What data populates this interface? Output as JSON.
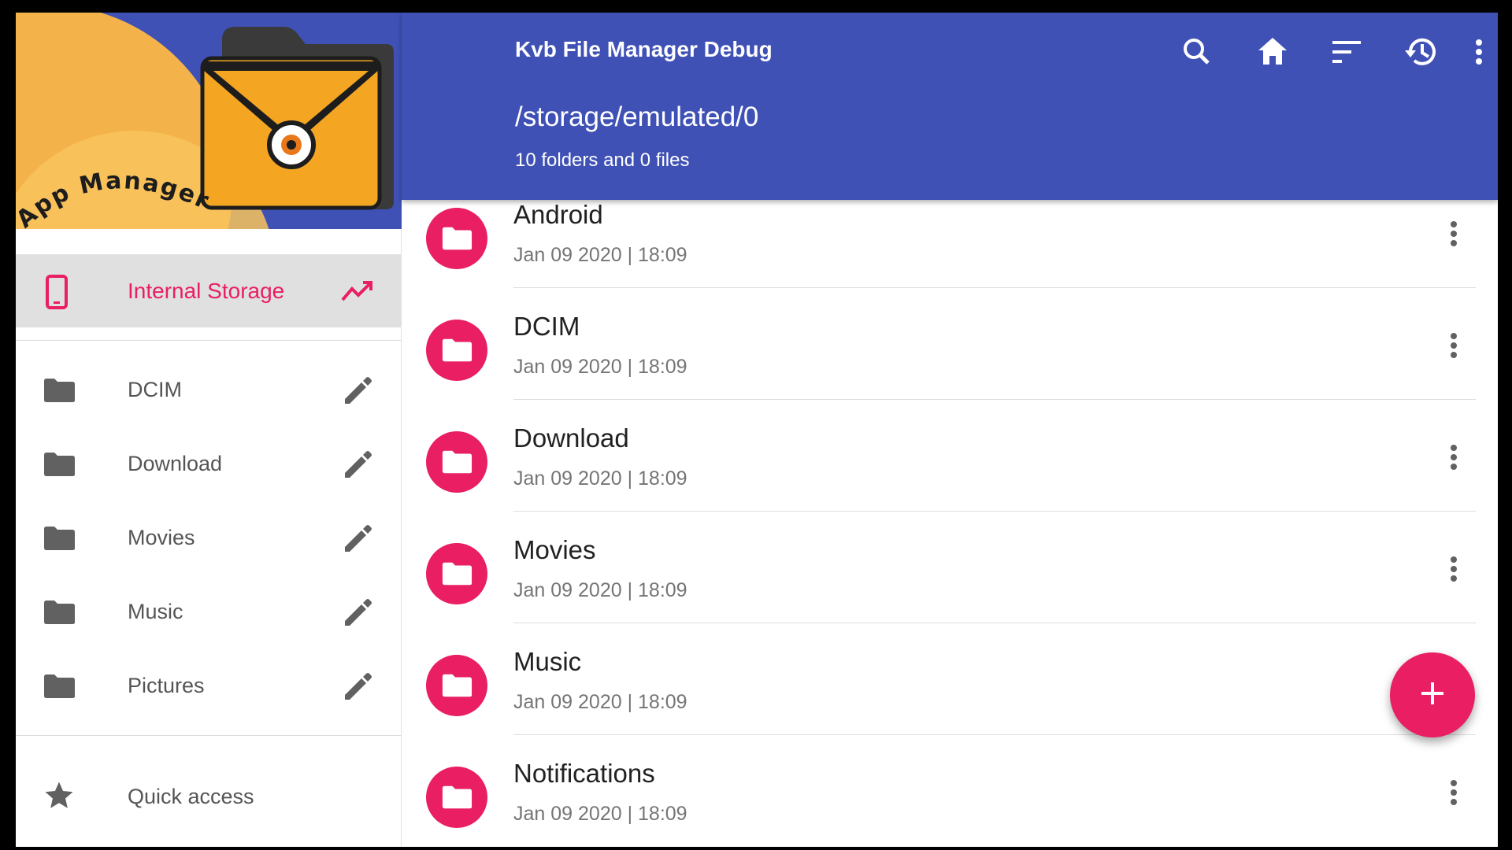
{
  "drawer": {
    "header_logo_text": "App Manager",
    "storage": {
      "label": "Internal Storage",
      "icon": "phone-icon",
      "trailing_icon": "trending-up-icon"
    },
    "bookmarks": [
      {
        "label": "DCIM",
        "icon": "folder-icon",
        "action_icon": "pencil-icon"
      },
      {
        "label": "Download",
        "icon": "folder-icon",
        "action_icon": "pencil-icon"
      },
      {
        "label": "Movies",
        "icon": "folder-icon",
        "action_icon": "pencil-icon"
      },
      {
        "label": "Music",
        "icon": "folder-icon",
        "action_icon": "pencil-icon"
      },
      {
        "label": "Pictures",
        "icon": "folder-icon",
        "action_icon": "pencil-icon"
      }
    ],
    "quick_access": {
      "label": "Quick access",
      "icon": "star-icon"
    }
  },
  "appbar": {
    "title": "Kvb File Manager Debug",
    "path": "/storage/emulated/0",
    "summary": "10 folders and 0 files",
    "actions": [
      "search-icon",
      "home-icon",
      "sort-icon",
      "history-icon",
      "more-vert-icon"
    ]
  },
  "files": [
    {
      "name": "Android",
      "meta": "Jan 09 2020 | 18:09"
    },
    {
      "name": "DCIM",
      "meta": "Jan 09 2020 | 18:09"
    },
    {
      "name": "Download",
      "meta": "Jan 09 2020 | 18:09"
    },
    {
      "name": "Movies",
      "meta": "Jan 09 2020 | 18:09"
    },
    {
      "name": "Music",
      "meta": "Jan 09 2020 | 18:09"
    },
    {
      "name": "Notifications",
      "meta": "Jan 09 2020 | 18:09"
    }
  ],
  "fab": {
    "icon": "plus-icon"
  },
  "colors": {
    "primary": "#3f51b5",
    "accent": "#e91e63",
    "logo_orange": "#f4a623",
    "logo_bg": "#f6b545"
  }
}
